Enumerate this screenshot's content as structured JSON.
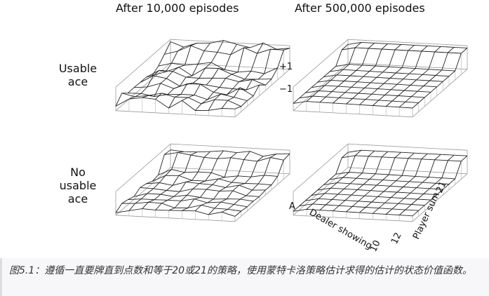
{
  "figure": {
    "col_titles": [
      "After 10,000 episodes",
      "After 500,000 episodes"
    ],
    "row_labels": [
      "Usable\nace",
      "No\nusable\nace"
    ],
    "z_ticks": [
      "+1",
      "−1"
    ],
    "x_axis": {
      "label": "Dealer showing",
      "ticks": [
        "A",
        "10"
      ]
    },
    "y_axis": {
      "label": "Player sum",
      "ticks": [
        "12",
        "21"
      ]
    }
  },
  "caption": "图5.1：遵循一直要牌直到点数和等于20或21的策略，使用蒙特卡洛策略估计求得的估计的状态价值函数。"
}
